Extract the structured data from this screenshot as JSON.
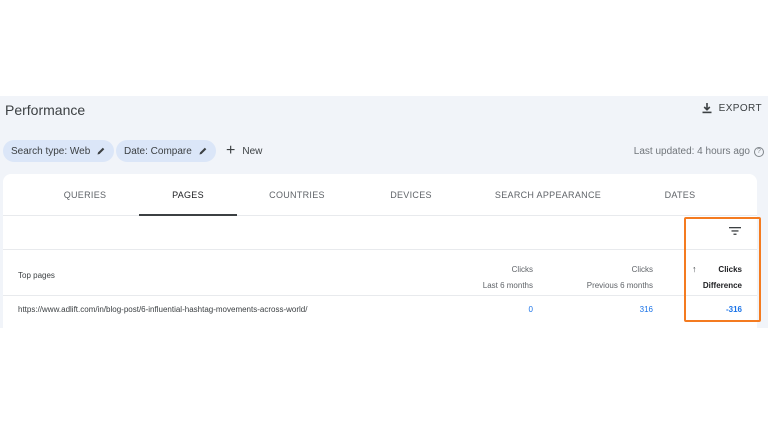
{
  "header": {
    "title": "Performance",
    "export_label": "EXPORT"
  },
  "filters": {
    "search_type": "Search type: Web",
    "date": "Date: Compare",
    "new_label": "New",
    "last_updated": "Last updated: 4 hours ago"
  },
  "tabs": [
    {
      "label": "QUERIES"
    },
    {
      "label": "PAGES"
    },
    {
      "label": "COUNTRIES"
    },
    {
      "label": "DEVICES"
    },
    {
      "label": "SEARCH APPEARANCE"
    },
    {
      "label": "DATES"
    }
  ],
  "active_tab": "PAGES",
  "table": {
    "first_column": "Top pages",
    "columns": [
      {
        "line1": "Clicks",
        "line2": "Last 6 months"
      },
      {
        "line1": "Clicks",
        "line2": "Previous 6 months"
      },
      {
        "line1": "Clicks",
        "line2": "Difference",
        "sorted": "ascending"
      }
    ],
    "rows": [
      {
        "page": "https://www.adlift.com/in/blog-post/6-influential-hashtag-movements-across-world/",
        "last_6_months": "0",
        "previous_6_months": "316",
        "difference": "-316"
      }
    ]
  },
  "colors": {
    "accent": "#1a73e8",
    "highlight": "#f47b20",
    "chip_bg": "#dbe6f8",
    "frame_bg": "#f1f4f9"
  },
  "icons": {
    "export": "download-icon",
    "edit": "pencil-icon",
    "new": "plus-icon",
    "help": "help-circle-icon",
    "filter": "filter-icon",
    "sort": "arrow-up-icon"
  }
}
